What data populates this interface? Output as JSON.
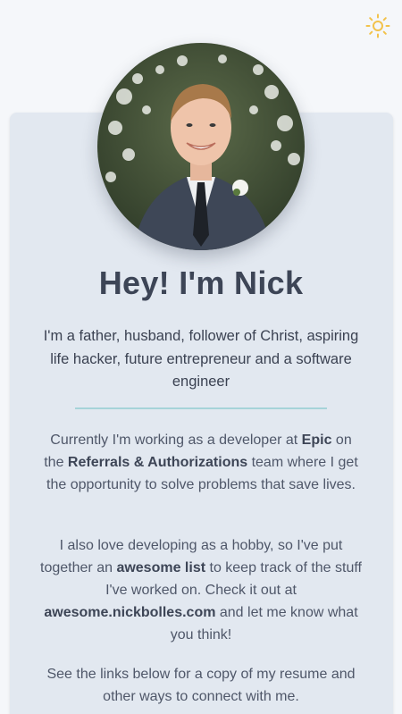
{
  "header": {
    "theme_toggle_icon": "sun-icon",
    "theme_icon_color": "#f2c24b"
  },
  "profile": {
    "avatar": "profile-photo",
    "heading": "Hey! I'm Nick",
    "tagline": "I'm a father, husband, follower of Christ, aspiring life hacker, future entrepreneur and a software engineer"
  },
  "about": {
    "p1_a": "Currently I'm working as a developer at ",
    "p1_company": "Epic",
    "p1_b": " on the ",
    "p1_team": "Referrals & Authorizations",
    "p1_c": " team where I get the opportunity to solve problems that save lives.",
    "p2_a": "I also love developing as a hobby, so I've put together an ",
    "p2_list": "awesome list",
    "p2_b": " to keep track of the stuff I've worked on. Check it out at ",
    "p2_site": "awesome.nickbolles.com",
    "p2_c": " and let me know what you think!",
    "p3": "See the links below for a copy of my resume and other ways to connect with me."
  },
  "colors": {
    "page_bg": "#f5f7fa",
    "card_bg": "#e2e8f0",
    "heading": "#3d4556",
    "divider": "#a6d3d9"
  }
}
